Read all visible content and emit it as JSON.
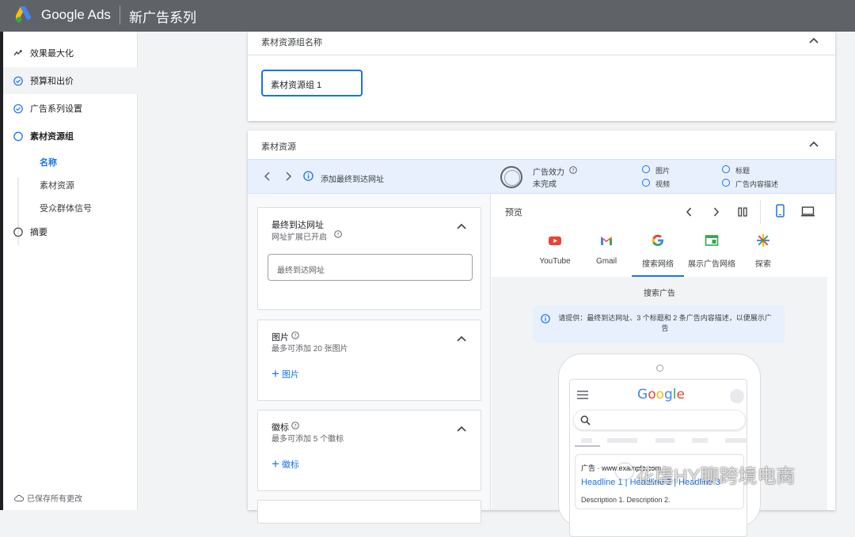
{
  "app": {
    "brand": "Google Ads",
    "campaign_title": "新广告系列"
  },
  "sidebar": {
    "items": [
      {
        "label": "效果最大化",
        "icon": "trend-icon",
        "state": "none"
      },
      {
        "label": "预算和出价",
        "icon": "check-circle-icon",
        "state": "done"
      },
      {
        "label": "广告系列设置",
        "icon": "check-circle-icon",
        "state": "done"
      },
      {
        "label": "素材资源组",
        "icon": "circle-icon",
        "state": "current"
      },
      {
        "label": "摘要",
        "icon": "circle-icon",
        "state": "pending"
      }
    ],
    "sub_items": [
      "名称",
      "素材资源",
      "受众群体信号"
    ],
    "saved_status": "已保存所有更改"
  },
  "asset_group_name": {
    "title": "素材资源组名称",
    "value": "素材资源组 1"
  },
  "assets": {
    "title": "素材资源",
    "info_text": "添加最终到达网址",
    "ad_strength": {
      "label": "广告效力",
      "value": "未完成"
    },
    "checklist": [
      "图片",
      "标题",
      "视频",
      "广告内容描述"
    ],
    "final_url": {
      "title": "最终到达网址",
      "subtitle": "网址扩展已开启",
      "placeholder": "最终到达网址"
    },
    "images": {
      "title": "图片",
      "subtitle": "最多可添加 20 张图片",
      "add_label": "图片"
    },
    "logos": {
      "title": "徽标",
      "subtitle": "最多可添加 5 个徽标",
      "add_label": "徽标"
    }
  },
  "preview": {
    "title": "预览",
    "tabs": [
      {
        "label": "YouTube",
        "icon": "youtube-icon"
      },
      {
        "label": "Gmail",
        "icon": "gmail-icon"
      },
      {
        "label": "搜索网络",
        "icon": "google-g-icon"
      },
      {
        "label": "展示广告网络",
        "icon": "display-network-icon"
      },
      {
        "label": "探索",
        "icon": "discover-icon"
      }
    ],
    "active_tab": "搜索网络",
    "section_label": "搜索广告",
    "notice": "请提供：最终到达网址、3 个标题和 2 条广告内容描述，以便展示广告",
    "google_logo": "Google",
    "ad": {
      "url": "广告 · www.example.com",
      "headline": "Headline 1 | Headline 2 | Headline 3",
      "description": "Description 1. Description 2."
    }
  },
  "watermark": "花虐HY聊跨境电商"
}
